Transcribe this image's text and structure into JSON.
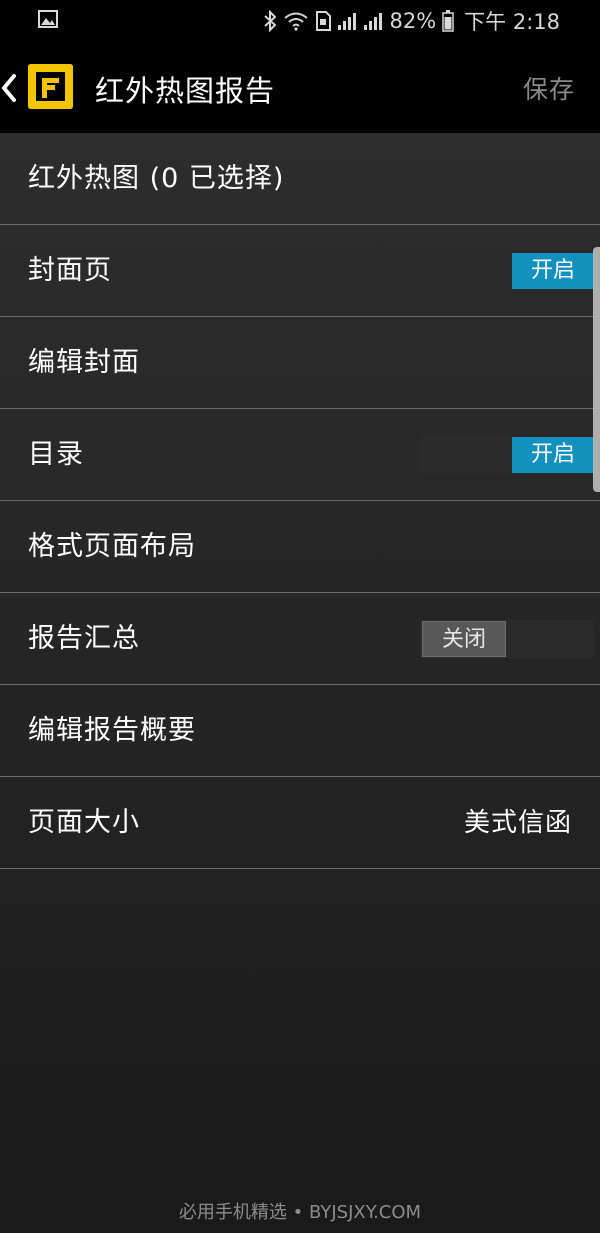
{
  "status_bar": {
    "battery": "82%",
    "time": "下午 2:18",
    "icons": [
      "picture-icon",
      "bluetooth-icon",
      "wifi-icon",
      "sim-icon",
      "signal-icon",
      "signal-icon",
      "battery-icon"
    ]
  },
  "app_bar": {
    "title": "红外热图报告",
    "save_label": "保存",
    "logo_letter": "F"
  },
  "rows": [
    {
      "label": "红外热图 (0 已选择)"
    },
    {
      "label": "封面页",
      "toggle": "开启"
    },
    {
      "label": "编辑封面"
    },
    {
      "label": "目录",
      "toggle": "开启"
    },
    {
      "label": "格式页面布局"
    },
    {
      "label": "报告汇总",
      "toggle": "关闭"
    },
    {
      "label": "编辑报告概要"
    },
    {
      "label": "页面大小",
      "value": "美式信函"
    }
  ],
  "footer": {
    "watermark": "必用手机精选 • BYJSJXY.COM"
  },
  "colors": {
    "accent": "#1291be",
    "logo": "#f5c400",
    "toggle_off": "#585858"
  }
}
